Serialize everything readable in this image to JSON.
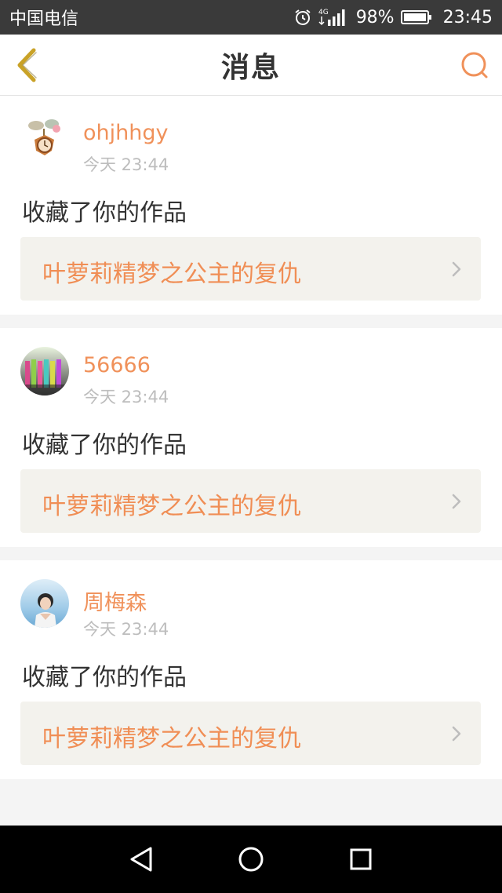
{
  "status_bar": {
    "carrier": "中国电信",
    "network": "4G",
    "battery": "98%",
    "time": "23:45"
  },
  "nav": {
    "title": "消息",
    "back_icon": "chevron-left-icon",
    "search_icon": "search-icon"
  },
  "colors": {
    "accent": "#f0915a",
    "back_icon": "#c9a227",
    "status_bar_bg": "#3a3a3a",
    "card_link_bg": "#f3f2ed"
  },
  "messages": [
    {
      "username": "ohjhhgy",
      "time": "今天 23:44",
      "action": "收藏了你的作品",
      "work_title": "叶萝莉精梦之公主的复仇"
    },
    {
      "username": "56666",
      "time": "今天 23:44",
      "action": "收藏了你的作品",
      "work_title": "叶萝莉精梦之公主的复仇"
    },
    {
      "username": "周梅森",
      "time": "今天 23:44",
      "action": "收藏了你的作品",
      "work_title": "叶萝莉精梦之公主的复仇"
    }
  ],
  "system_nav": {
    "back": "back-triangle-icon",
    "home": "home-circle-icon",
    "recents": "recents-square-icon"
  }
}
